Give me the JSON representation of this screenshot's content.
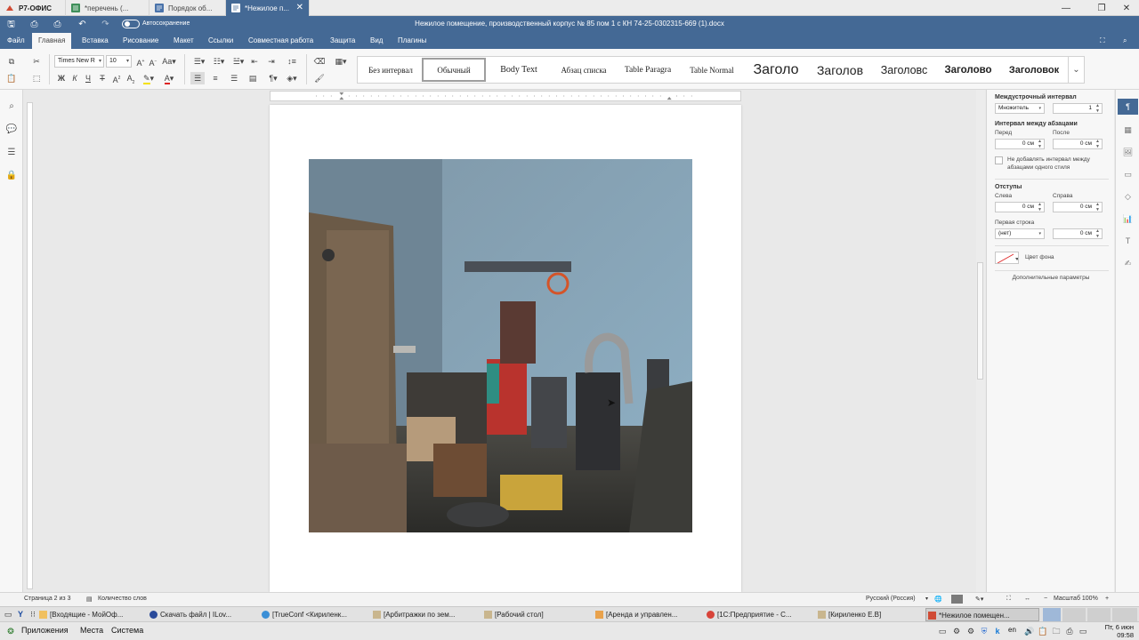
{
  "app": {
    "name": "Р7-ОФИС"
  },
  "tabs": [
    {
      "label": "*перечень (..."
    },
    {
      "label": "Порядок об..."
    },
    {
      "label": "*Нежилое п..."
    }
  ],
  "window": {
    "title": "Нежилое помещение, производственный корпус № 85 пом 1 с КН 74-25-0302315-669 (1).docx",
    "autosave_label": "Автосохранение"
  },
  "menu": [
    "Файл",
    "Главная",
    "Вставка",
    "Рисование",
    "Макет",
    "Ссылки",
    "Совместная работа",
    "Защита",
    "Вид",
    "Плагины"
  ],
  "toolbar": {
    "font_name": "Times New R",
    "font_size": "10"
  },
  "styles": [
    "Без интервал",
    "Обычный",
    "Body Text",
    "Абзац списка",
    "Table Paragra",
    "Table Normal",
    "Заголо",
    "Заголов",
    "Заголовс",
    "Заголово",
    "Заголовок"
  ],
  "paragraph_panel": {
    "line_spacing_title": "Междустрочный интервал",
    "line_spacing_type": "Множитель",
    "line_spacing_value": "1",
    "para_spacing_title": "Интервал между абзацами",
    "before_label": "Перед",
    "after_label": "После",
    "before_value": "0 см",
    "after_value": "0 см",
    "no_spacing_line1": "Не добавлять интервал между",
    "no_spacing_line2": "абзацами одного стиля",
    "indents_title": "Отступы",
    "left_label": "Слева",
    "right_label": "Справа",
    "left_value": "0 см",
    "right_value": "0 см",
    "first_line_label": "Первая строка",
    "first_line_type": "(нет)",
    "first_line_value": "0 см",
    "bg_color_label": "Цвет фона",
    "advanced_link": "Дополнительные параметры"
  },
  "status": {
    "page": "Страница 2 из 3",
    "word_count": "Количество слов",
    "language": "Русский (Россия)",
    "zoom": "Масштаб 100%"
  },
  "taskbar": [
    {
      "label": "[Входящие - МойОф..."
    },
    {
      "label": "Скачать файл | ILov..."
    },
    {
      "label": "[TrueConf <Кириленк..."
    },
    {
      "label": "[Арбитражки по зем..."
    },
    {
      "label": "[Рабочий стол]"
    },
    {
      "label": "[Аренда и управлен..."
    },
    {
      "label": "[1С:Предприятие - С..."
    },
    {
      "label": "[Кириленко Е.В]"
    },
    {
      "label": "*Нежилое помещен..."
    }
  ],
  "panel": {
    "apps": "Приложения",
    "places": "Места",
    "system": "Система",
    "lang": "en",
    "date": "Пт, 6 июн",
    "time": "09:58"
  },
  "colors": {
    "accent": "#446995",
    "toolbar_bg": "#f7f7f7",
    "canvas_bg": "#e9e9e9"
  }
}
